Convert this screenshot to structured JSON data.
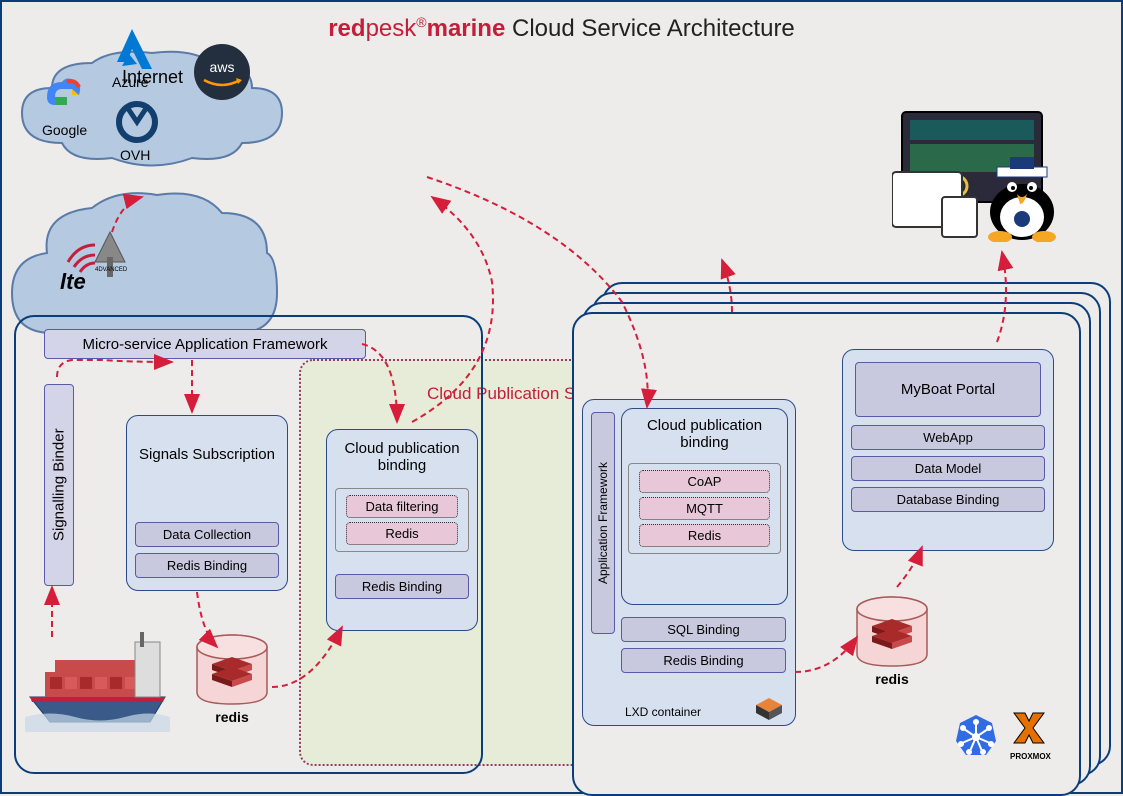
{
  "title": {
    "red": "red",
    "pesk": "pesk",
    "reg": "®",
    "marine": "marine",
    "rest": " Cloud Service Architecture"
  },
  "internet": "Internet",
  "providers": {
    "google": "Google",
    "azure": "Azure",
    "aws": "aws",
    "ovh": "OVH"
  },
  "lte": {
    "label": "lte",
    "advanced": "4DVANCED"
  },
  "left_panel": {
    "micro_framework": "Micro-service Application Framework",
    "signalling_binder": "Signalling Binder",
    "signals_subscription": {
      "title": "Signals Subscription",
      "data_collection": "Data Collection",
      "redis_binding": "Redis Binding"
    },
    "cloud_pub": {
      "title": "Cloud publication binding",
      "data_filtering": "Data filtering",
      "redis_inner": "Redis",
      "redis_binding": "Redis Binding"
    }
  },
  "cps_title": "Cloud Publication Service",
  "right_panel": {
    "app_framework": "Application Framework",
    "cloud_pub": {
      "title": "Cloud publication binding",
      "coap": "CoAP",
      "mqtt": "MQTT",
      "redis": "Redis"
    },
    "sql_binding": "SQL Binding",
    "redis_binding": "Redis Binding",
    "lxd_label": "LXD container",
    "myboat": {
      "title": "MyBoat Portal",
      "webapp": "WebApp",
      "data_model": "Data Model",
      "db_binding": "Database Binding"
    }
  },
  "logos": {
    "redis": "redis",
    "k8s": "kubernetes-icon",
    "proxmox": "PROXMOX"
  }
}
